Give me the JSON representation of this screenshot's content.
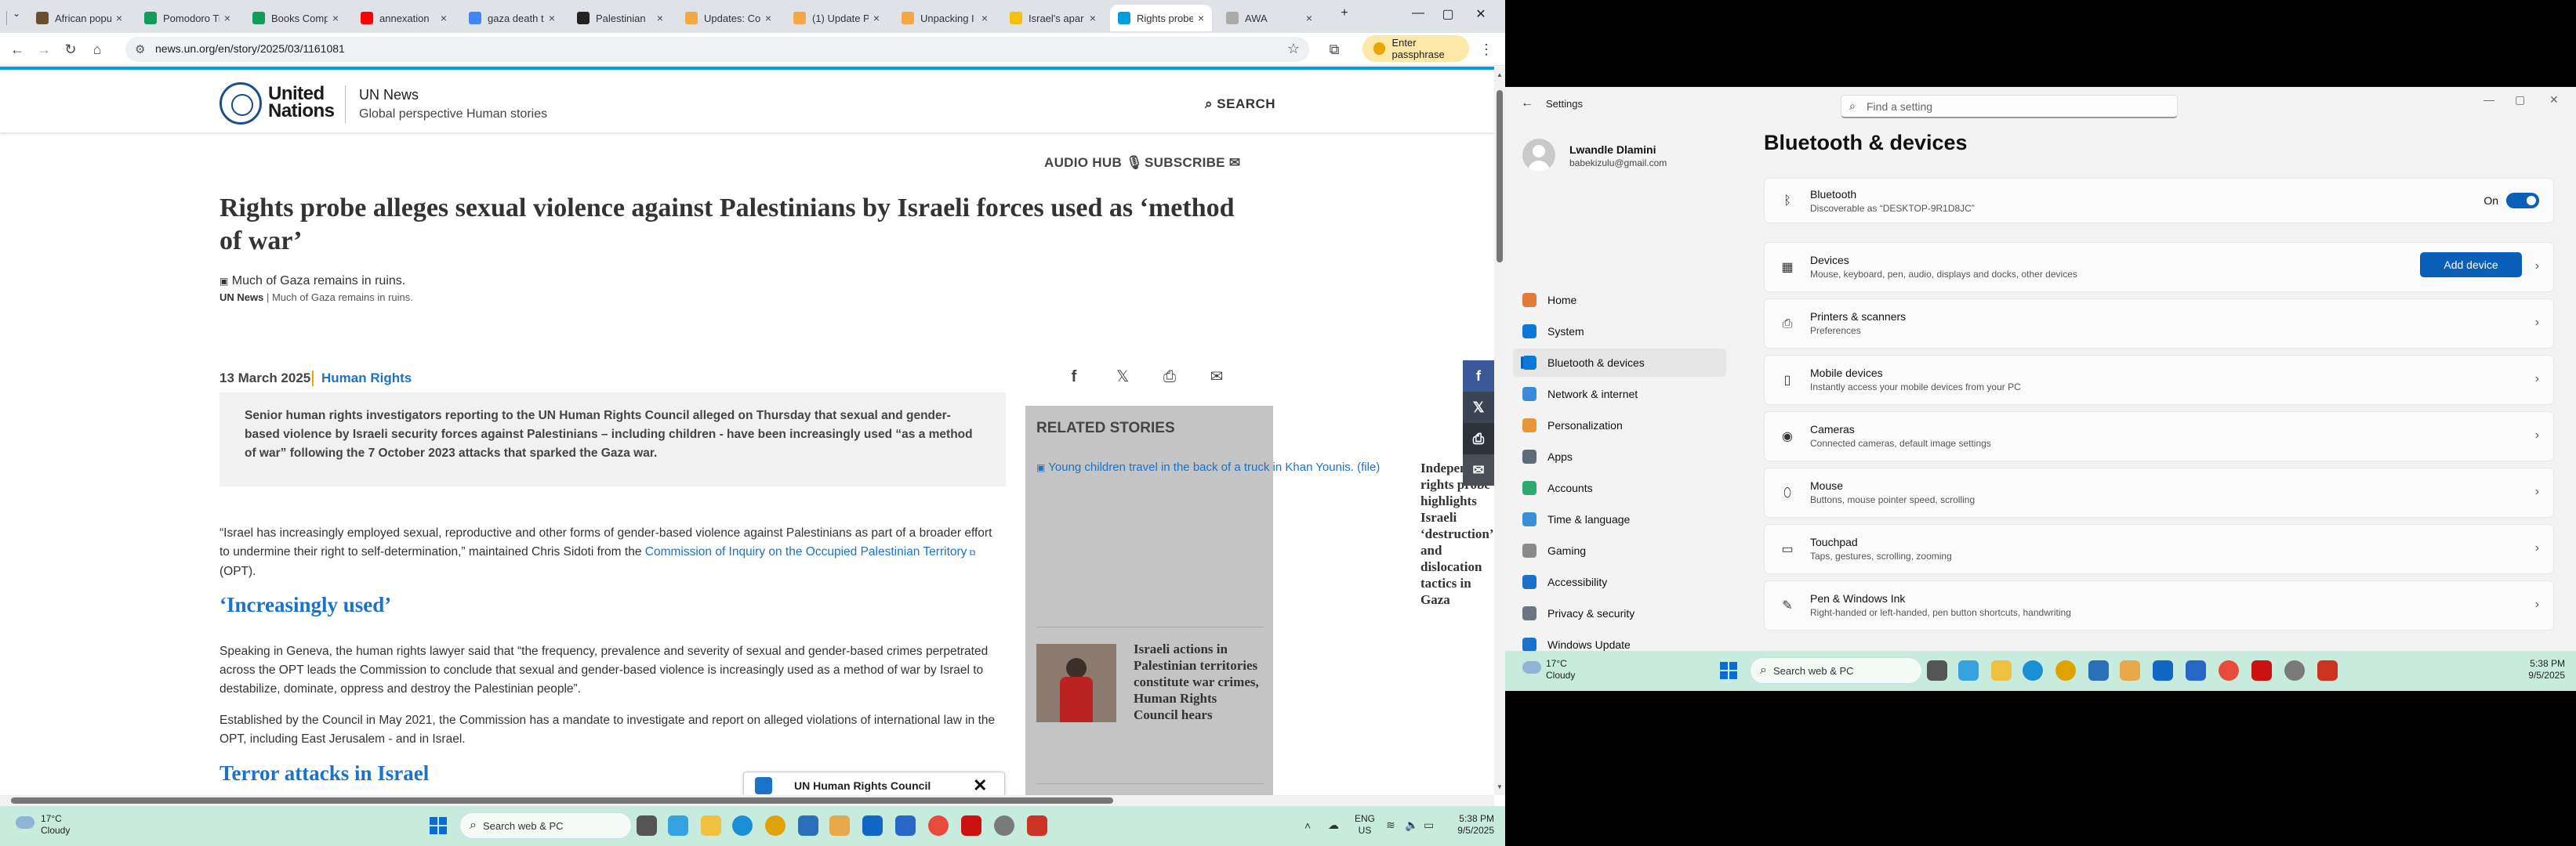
{
  "browser": {
    "tabs": [
      {
        "label": "African popu",
        "color": "#6b4e2e"
      },
      {
        "label": "Pomodoro Ti",
        "color": "#0f9d58"
      },
      {
        "label": "Books Comp",
        "color": "#0f9d58"
      },
      {
        "label": "annexation",
        "color": "#ff0000"
      },
      {
        "label": "gaza death t",
        "color": "#4285f4"
      },
      {
        "label": "Palestinian",
        "color": "#222222"
      },
      {
        "label": "Updates: Co",
        "color": "#f4a742"
      },
      {
        "label": "(1) Update P",
        "color": "#f4a742"
      },
      {
        "label": "Unpacking I",
        "color": "#f4a742"
      },
      {
        "label": "Israel's apar",
        "color": "#f4c20d"
      },
      {
        "label": "Rights probe",
        "color": "#009edb"
      },
      {
        "label": "AWA",
        "color": "#aaaaaa"
      }
    ],
    "new_tab": "+",
    "window_controls": {
      "minimize": "—",
      "maximize": "▢",
      "close": "✕"
    },
    "url": "news.un.org/en/story/2025/03/1161081",
    "passphrase_label": "Enter passphrase",
    "icons": {
      "back": "←",
      "forward": "→",
      "reload": "↻",
      "home": "⌂",
      "site-info": "⚙",
      "bookmark": "☆",
      "extensions": "⧉",
      "menu": "⋮"
    }
  },
  "article": {
    "site_name_line1": "United",
    "site_name_line2": "Nations",
    "news_label": "UN News",
    "tagline": "Global perspective Human stories",
    "search_label": "SEARCH",
    "audio_hub": "AUDIO HUB",
    "subscribe": "SUBSCRIBE",
    "headline": "Rights probe alleges sexual violence against Palestinians by Israeli forces used as ‘method of war’",
    "image_alt": "Much of Gaza remains in ruins.",
    "caption_credit": "UN News",
    "caption_text": "| Much of Gaza remains in ruins.",
    "date": "13 March 2025",
    "topic": "Human Rights",
    "summary": "Senior human rights investigators reporting to the UN Human Rights Council alleged on Thursday that sexual and gender-based violence by Israeli security forces against Palestinians – including children - have been increasingly used “as a method of war” following the 7 October 2023 attacks that sparked the Gaza war.",
    "para1_text": "“Israel has increasingly employed sexual, reproductive and other forms of gender-based violence against Palestinians as part of a broader effort to undermine their right to self-determination,” maintained Chris Sidoti from the ",
    "para1_link": "Commission of Inquiry on the Occupied Palestinian Territory",
    "para1_end": " (OPT).",
    "subhead1": "‘Increasingly used’",
    "para2": "Speaking in Geneva, the human rights lawyer said that “the frequency, prevalence and severity of sexual and gender-based crimes perpetrated across the OPT leads the Commission to conclude that sexual and gender-based violence is increasingly used as a method of war by Israel to destabilize, dominate, oppress and destroy the Palestinian people”.",
    "para3": "Established by the Council in May 2021, the Commission has a mandate to investigate and report on alleged violations of international law in the OPT, including East Jerusalem - and in Israel.",
    "subhead2": "Terror attacks in Israel",
    "related_title": "RELATED STORIES",
    "related_image_alt": "Young children travel in the back of a truck in Khan Younis. (file)",
    "related_story": "Israeli actions in Palestinian territories constitute war crimes, Human Rights Council hears",
    "cut_story": "Independent rights probe highlights Israeli ‘destruction’ and dislocation tactics in Gaza",
    "toast_name": "UN Human Rights Council",
    "toast_close": "✕"
  },
  "taskbar_left": {
    "temp": "17°C",
    "weather": "Cloudy",
    "search_placeholder": "Search web & PC",
    "lang1": "ENG",
    "lang2": "US",
    "time": "5:38 PM",
    "date": "9/5/2025"
  },
  "settings": {
    "window_title": "Settings",
    "search_placeholder": "Find a setting",
    "user_name": "Lwandle Dlamini",
    "user_email": "babekizulu@gmail.com",
    "nav": [
      {
        "label": "Home",
        "color": "#e07b39"
      },
      {
        "label": "System",
        "color": "#0a78d7"
      },
      {
        "label": "Bluetooth & devices",
        "color": "#0a78d7"
      },
      {
        "label": "Network & internet",
        "color": "#3b8ad9"
      },
      {
        "label": "Personalization",
        "color": "#e8963a"
      },
      {
        "label": "Apps",
        "color": "#5f6b7a"
      },
      {
        "label": "Accounts",
        "color": "#2eaa70"
      },
      {
        "label": "Time & language",
        "color": "#3a8fd6"
      },
      {
        "label": "Gaming",
        "color": "#8a8a8a"
      },
      {
        "label": "Accessibility",
        "color": "#1c6fc9"
      },
      {
        "label": "Privacy & security",
        "color": "#6b7480"
      },
      {
        "label": "Windows Update",
        "color": "#1a73c9"
      }
    ],
    "heading": "Bluetooth & devices",
    "bluetooth": {
      "title": "Bluetooth",
      "subtitle": "Discoverable as “DESKTOP-9R1D8JC”",
      "state": "On"
    },
    "cards": [
      {
        "title": "Devices",
        "subtitle": "Mouse, keyboard, pen, audio, displays and docks, other devices",
        "icon": "devices-icon",
        "glyph": "▦"
      },
      {
        "title": "Printers & scanners",
        "subtitle": "Preferences",
        "icon": "printer-icon",
        "glyph": "⎙"
      },
      {
        "title": "Mobile devices",
        "subtitle": "Instantly access your mobile devices from your PC",
        "icon": "phone-icon",
        "glyph": "▯"
      },
      {
        "title": "Cameras",
        "subtitle": "Connected cameras, default image settings",
        "icon": "camera-icon",
        "glyph": "◉"
      },
      {
        "title": "Mouse",
        "subtitle": "Buttons, mouse pointer speed, scrolling",
        "icon": "mouse-icon",
        "glyph": "⬯"
      },
      {
        "title": "Touchpad",
        "subtitle": "Taps, gestures, scrolling, zooming",
        "icon": "touchpad-icon",
        "glyph": "▭"
      },
      {
        "title": "Pen & Windows Ink",
        "subtitle": "Right-handed or left-handed, pen button shortcuts, handwriting",
        "icon": "pen-icon",
        "glyph": "✎"
      }
    ],
    "add_device": "Add device"
  },
  "taskbar_right": {
    "temp": "17°C",
    "weather": "Cloudy",
    "search_placeholder": "Search web & PC",
    "time": "5:38 PM",
    "date": "9/5/2025"
  }
}
